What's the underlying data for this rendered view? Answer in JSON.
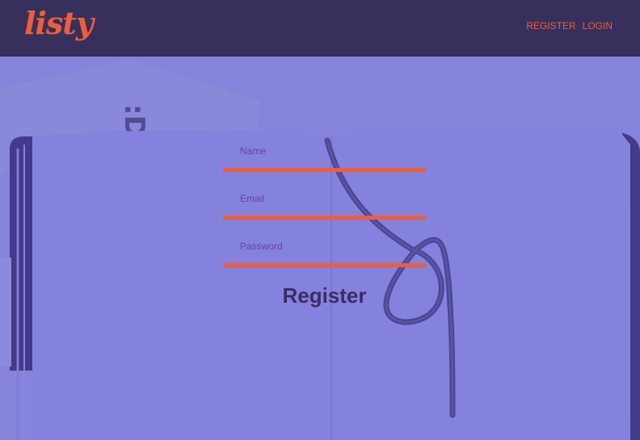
{
  "brand": {
    "logo": "listy",
    "accent": "#f05d3b",
    "header_bg": "#37305c",
    "page_bg": "#8683db"
  },
  "nav": {
    "register": "REGISTER",
    "login": "LOGIN"
  },
  "form": {
    "fields": [
      {
        "label": "Name",
        "value": ""
      },
      {
        "label": "Email",
        "value": ""
      },
      {
        "label": "Password",
        "value": ""
      }
    ],
    "submit_label": "Register"
  },
  "background": {
    "tag_text": ":D"
  }
}
